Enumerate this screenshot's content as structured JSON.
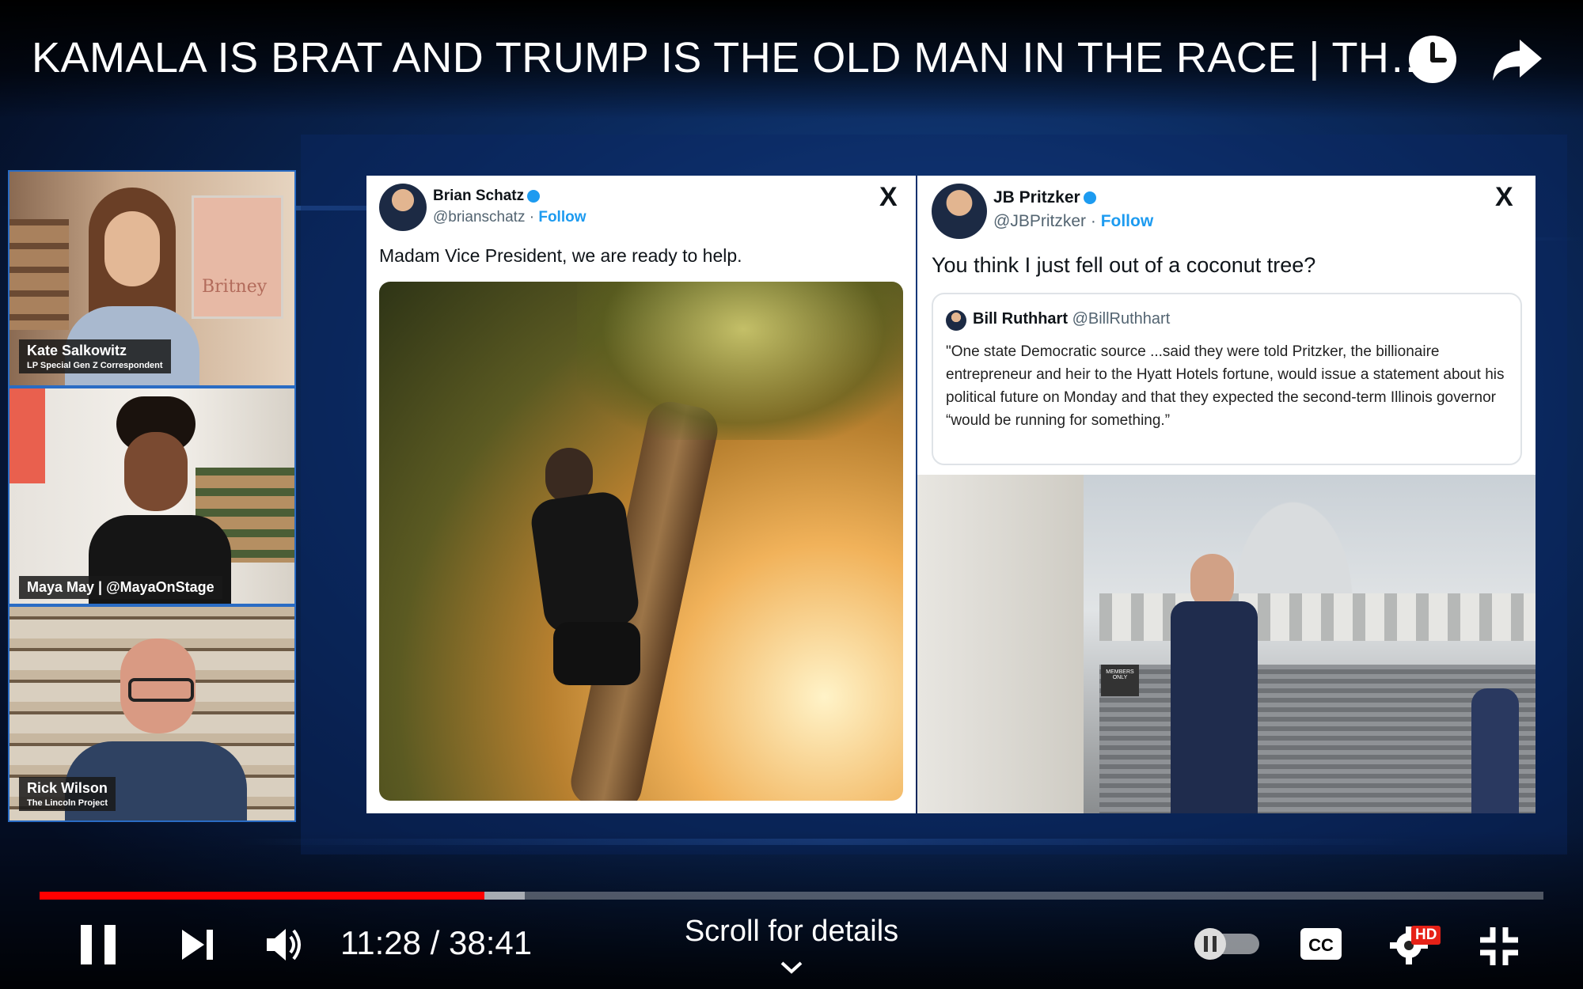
{
  "player": {
    "title": "KAMALA IS BRAT AND TRUMP IS THE OLD MAN IN THE RACE | TH…",
    "time_current": "11:28",
    "time_separator": "/",
    "time_total": "38:41",
    "progress_played": 0.2959,
    "progress_buffered": 0.3225,
    "scroll_hint": "Scroll for details",
    "quality_badge": "HD",
    "icons": {
      "watch_later": "clock-icon",
      "share": "share-arrow-icon",
      "play_pause": "pause-icon",
      "next": "skip-next-icon",
      "volume": "volume-icon",
      "autoplay": "autoplay-toggle-icon",
      "captions": "cc-icon",
      "settings": "gear-icon",
      "fullscreen": "exit-fullscreen-icon",
      "scroll": "chevron-down-icon"
    }
  },
  "panelists": [
    {
      "name": "Kate Salkowitz",
      "subtitle": "LP Special Gen Z Correspondent",
      "poster_text": "Britney"
    },
    {
      "name": "Maya May | @MayaOnStage",
      "subtitle": ""
    },
    {
      "name": "Rick Wilson",
      "subtitle": "The Lincoln Project"
    }
  ],
  "tweets": {
    "left": {
      "name": "Brian Schatz",
      "handle": "@brianschatz",
      "separator": "·",
      "follow": "Follow",
      "text": "Madam Vice President, we are ready to help.",
      "logo": "X"
    },
    "right": {
      "name": "JB Pritzker",
      "handle": "@JBPritzker",
      "separator": "·",
      "follow": "Follow",
      "text": "You think I just fell out of a coconut tree?",
      "logo": "X",
      "quote": {
        "name": "Bill Ruthhart",
        "handle": "@BillRuthhart",
        "text": "\"One state Democratic source ...said they were told Pritzker, the billionaire entrepreneur and heir to the Hyatt Hotels fortune, would issue a statement about his political future on Monday and that they expected the second-term Illinois governor “would be running for something.”"
      },
      "photo_sign": "MEMBERS ONLY"
    }
  }
}
